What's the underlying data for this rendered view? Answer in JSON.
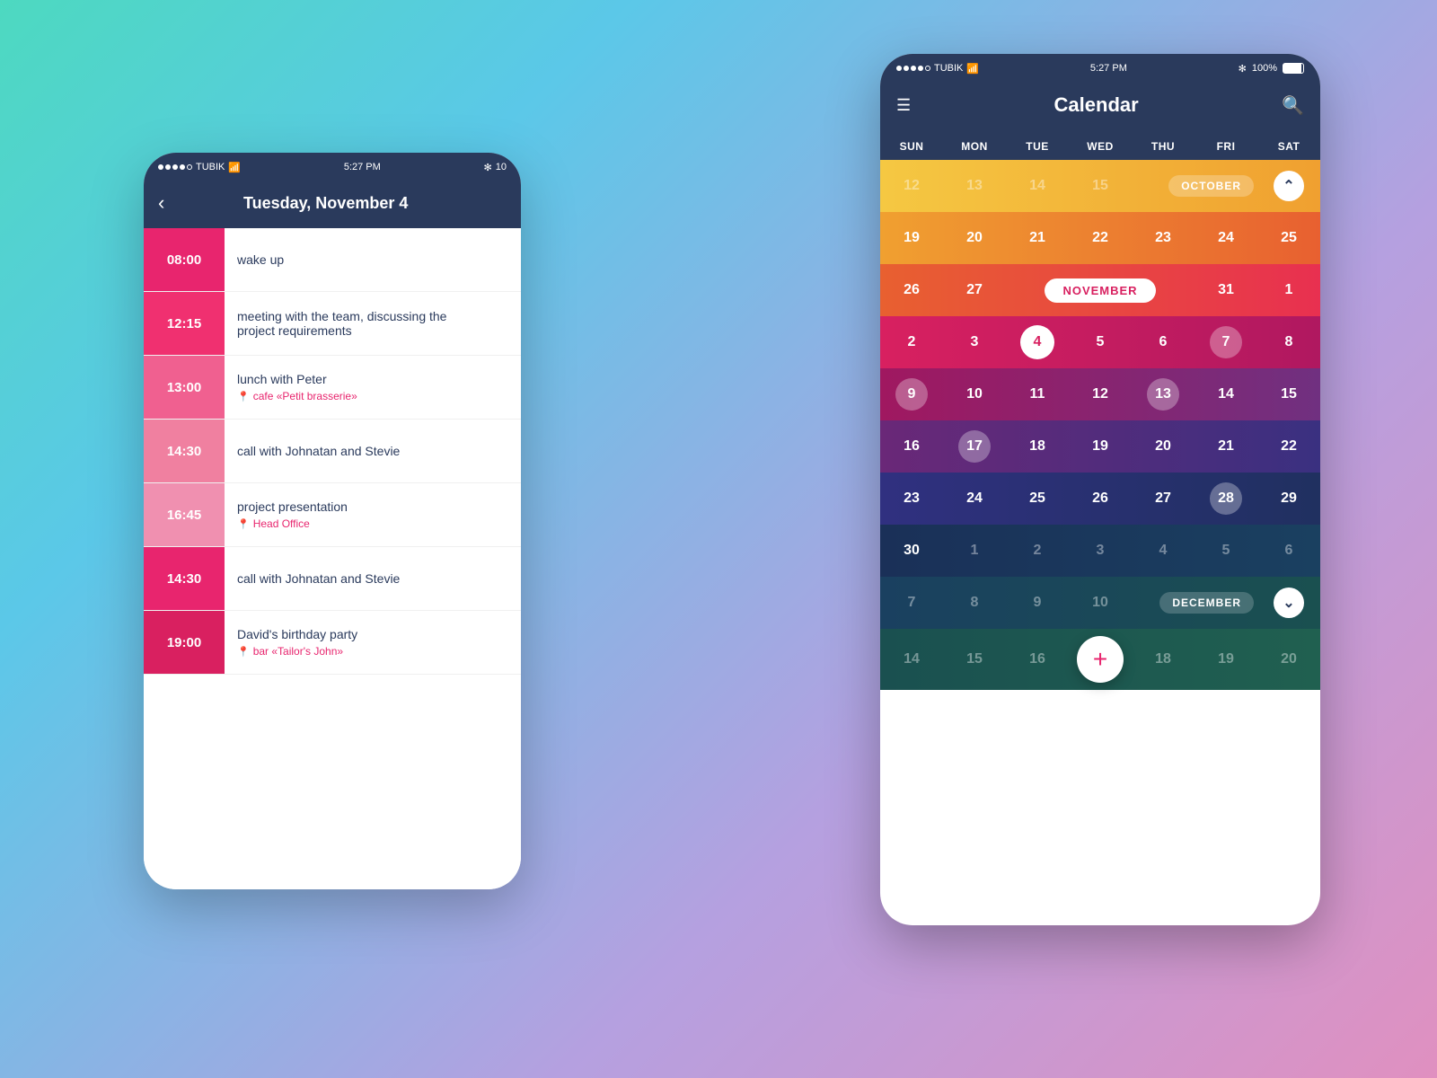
{
  "background": {
    "gradient": "linear-gradient(135deg, #4dd9c0 0%, #5bc8e8 25%, #b5a0e0 65%, #e090c0 100%)"
  },
  "phone_left": {
    "status_bar": {
      "carrier": "TUBIK",
      "signal_dots": 4,
      "wifi": "wifi",
      "time": "5:27 PM",
      "bluetooth": "✻",
      "battery": "10"
    },
    "nav": {
      "back_label": "‹",
      "title": "Tuesday, November 4"
    },
    "events": [
      {
        "time": "08:00",
        "title": "wake up",
        "location": "",
        "color": "pink"
      },
      {
        "time": "12:15",
        "title": "meeting with the team, discussing the project requirements",
        "location": "",
        "color": "pink2"
      },
      {
        "time": "13:00",
        "title": "lunch with Peter",
        "location": "cafe «Petit brasserie»",
        "color": "pink3"
      },
      {
        "time": "14:30",
        "title": "call with Johnatan and Stevie",
        "location": "",
        "color": "pink4"
      },
      {
        "time": "16:45",
        "title": "project presentation",
        "location": "Head Office",
        "color": "pink5"
      },
      {
        "time": "14:30",
        "title": "call with Johnatan and Stevie",
        "location": "",
        "color": "pink6"
      },
      {
        "time": "19:00",
        "title": "David's birthday party",
        "location": "bar «Tailor's John»",
        "color": "pink7"
      }
    ]
  },
  "phone_right": {
    "status_bar": {
      "carrier": "TUBIK",
      "wifi": "wifi",
      "time": "5:27 PM",
      "bluetooth": "✻",
      "battery": "100%"
    },
    "nav": {
      "menu_icon": "☰",
      "title": "Calendar",
      "search_icon": "🔍"
    },
    "day_names": [
      "SUN",
      "MON",
      "TUE",
      "WED",
      "THU",
      "FRI",
      "SAT"
    ],
    "calendar": {
      "october_label": "OCTOBER",
      "november_label": "NOVEMBER",
      "december_label": "DECEMBER",
      "rows": [
        {
          "type": "dates",
          "style": "row-oct1",
          "cells": [
            {
              "num": "12",
              "faded": true
            },
            {
              "num": "13",
              "faded": true
            },
            {
              "num": "14",
              "faded": true
            },
            {
              "num": "15",
              "faded": true
            },
            {
              "num": "",
              "is_label": true,
              "label": "OCTOBER",
              "span": 2
            },
            {
              "num": "",
              "is_chevron_up": true
            }
          ]
        },
        {
          "type": "dates",
          "style": "row-oct2",
          "cells": [
            {
              "num": "19"
            },
            {
              "num": "20"
            },
            {
              "num": "21"
            },
            {
              "num": "22"
            },
            {
              "num": "23"
            },
            {
              "num": "24"
            },
            {
              "num": "25"
            }
          ]
        },
        {
          "type": "month_row",
          "style": "row-nov-label",
          "cells": [
            {
              "num": "26"
            },
            {
              "num": "27"
            },
            {
              "num": "NOVEMBER",
              "is_month": true,
              "span": 3
            },
            {
              "num": "31"
            },
            {
              "num": "1"
            }
          ]
        },
        {
          "type": "dates",
          "style": "row-nov1",
          "cells": [
            {
              "num": "2"
            },
            {
              "num": "3"
            },
            {
              "num": "4",
              "selected_white": true
            },
            {
              "num": "5"
            },
            {
              "num": "6"
            },
            {
              "num": "7",
              "selected": true
            },
            {
              "num": "8"
            }
          ]
        },
        {
          "type": "dates",
          "style": "row-nov2",
          "cells": [
            {
              "num": "9",
              "selected": true
            },
            {
              "num": "10"
            },
            {
              "num": "11"
            },
            {
              "num": "12"
            },
            {
              "num": "13",
              "selected": true
            },
            {
              "num": "14"
            },
            {
              "num": "15"
            }
          ]
        },
        {
          "type": "dates",
          "style": "row-nov3",
          "cells": [
            {
              "num": "16"
            },
            {
              "num": "17",
              "selected": true
            },
            {
              "num": "18"
            },
            {
              "num": "19"
            },
            {
              "num": "20"
            },
            {
              "num": "21"
            },
            {
              "num": "22"
            }
          ]
        },
        {
          "type": "dates",
          "style": "row-nov4",
          "cells": [
            {
              "num": "23"
            },
            {
              "num": "24"
            },
            {
              "num": "25"
            },
            {
              "num": "26"
            },
            {
              "num": "27"
            },
            {
              "num": "28",
              "selected": true
            },
            {
              "num": "29"
            }
          ]
        },
        {
          "type": "dates",
          "style": "row-dec1",
          "cells": [
            {
              "num": "30"
            },
            {
              "num": "1",
              "faded": true
            },
            {
              "num": "2",
              "faded": true
            },
            {
              "num": "3",
              "faded": true
            },
            {
              "num": "4",
              "faded": true
            },
            {
              "num": "5",
              "faded": true
            },
            {
              "num": "6",
              "faded": true
            }
          ]
        },
        {
          "type": "month_row_dec",
          "style": "row-dec2",
          "cells": [
            {
              "num": "7",
              "faded": true
            },
            {
              "num": "8",
              "faded": true
            },
            {
              "num": "9",
              "faded": true
            },
            {
              "num": "10",
              "faded": true
            },
            {
              "num": "DECEMBER",
              "is_month": true,
              "span": 2
            },
            {
              "num": "",
              "is_chevron_down": true
            }
          ]
        },
        {
          "type": "dates",
          "style": "row-dec2",
          "cells": [
            {
              "num": "14",
              "faded": true
            },
            {
              "num": "15",
              "faded": true
            },
            {
              "num": "16",
              "faded": true
            },
            {
              "num": "",
              "is_fab": true
            },
            {
              "num": "18",
              "faded": true
            },
            {
              "num": "19",
              "faded": true
            },
            {
              "num": "20",
              "faded": true
            }
          ]
        }
      ]
    },
    "fab_label": "+"
  }
}
